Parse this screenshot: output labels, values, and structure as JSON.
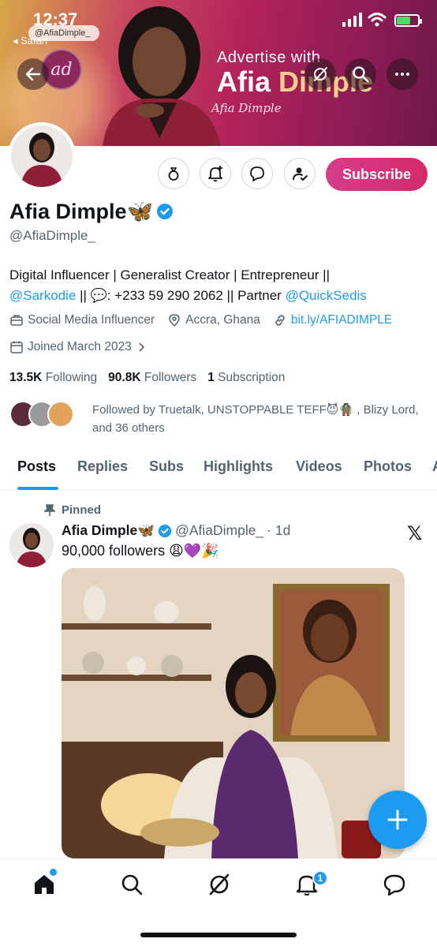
{
  "status_bar": {
    "time": "12:37",
    "url": "@AfiaDimple_",
    "back_app": "◂ Safari"
  },
  "banner": {
    "line1": "Advertise with",
    "line2_a": "Afia ",
    "line2_b": "Dimple",
    "logo_text": "ad",
    "signature": "Afia Dimple"
  },
  "header_nav": {
    "back": "back-arrow-icon",
    "grok": "grok-icon",
    "search": "search-icon",
    "more": "more-icon"
  },
  "actions": {
    "subscribe_label": "Subscribe",
    "icons": [
      "money-bag-icon",
      "notification-add-icon",
      "message-icon",
      "follow-check-icon"
    ]
  },
  "profile": {
    "name": "Afia Dimple🦋",
    "handle": "@AfiaDimple_",
    "bio_part1": "Digital Influencer | Generalist Creator | Entrepreneur ||",
    "bio_mention1": "@Sarkodie",
    "bio_part2": " || 💬: +233 59 290 2062 || Partner ",
    "bio_mention2": "@QuickSedis",
    "category": "Social Media Influencer",
    "location": "Accra, Ghana",
    "website": "bit.ly/AFIADIMPLE",
    "joined": "Joined March 2023",
    "following_count": "13.5K",
    "following_label": "Following",
    "followers_count": "90.8K",
    "followers_label": "Followers",
    "subscriptions_count": "1",
    "subscriptions_label": "Subscription",
    "followed_by": "Followed by Truetalk, UNSTOPPABLE TEFF😈🧌 , Blizy Lord, and 36 others"
  },
  "tabs": [
    "Posts",
    "Replies",
    "Subs",
    "Highlights",
    "Videos",
    "Photos",
    "A"
  ],
  "post": {
    "pinned_label": "Pinned",
    "author": "Afia Dimple🦋",
    "handle": "@AfiaDimple_",
    "time": "· 1d",
    "text": "90,000 followers 😩💜🎉"
  },
  "bottom_nav": {
    "notifications_badge": "1"
  },
  "colors": {
    "accent": "#1d9bf0",
    "subscribe": "#d63d8b",
    "verified": "#1d9bf0"
  }
}
